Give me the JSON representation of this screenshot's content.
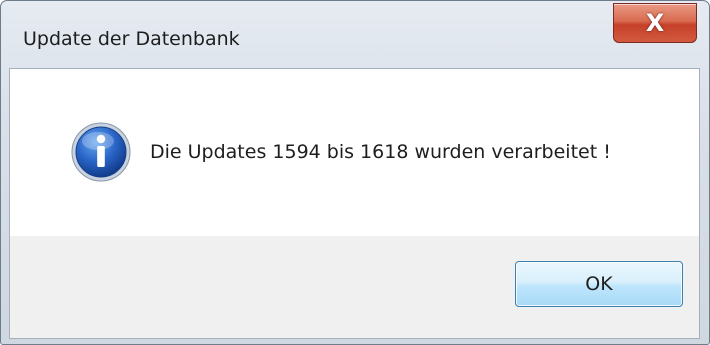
{
  "window": {
    "title": "Update der Datenbank",
    "close_label": "X"
  },
  "dialog": {
    "icon": "info-icon",
    "message": "Die Updates 1594 bis 1618 wurden verarbeitet !",
    "ok_label": "OK"
  },
  "colors": {
    "close_button": "#c6402a",
    "ok_button_border": "#3c7fb1",
    "info_icon": "#1f58b8"
  }
}
